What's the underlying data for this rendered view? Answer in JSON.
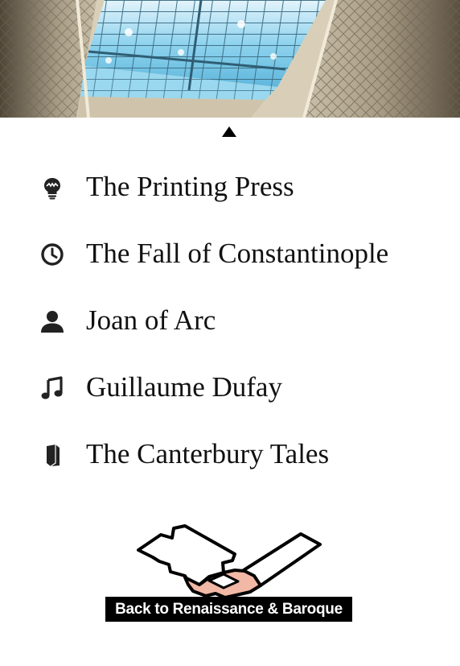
{
  "hero": {
    "image": "ornate-glass-ceiling-skylight"
  },
  "toggle": {
    "icon": "triangle-up-icon"
  },
  "topics": [
    {
      "label": "The Printing Press",
      "icon": "lightbulb-icon"
    },
    {
      "label": "The Fall of Constantinople",
      "icon": "clock-icon"
    },
    {
      "label": "Joan of Arc",
      "icon": "person-icon"
    },
    {
      "label": "Guillaume Dufay",
      "icon": "music-note-icon"
    },
    {
      "label": "The Canterbury Tales",
      "icon": "book-icon"
    }
  ],
  "back_link": {
    "label": "Back to Renaissance & Baroque",
    "map_highlight_color": "#f2b8a6"
  },
  "colors": {
    "text": "#111111",
    "button_background": "#000000",
    "button_text": "#ffffff"
  }
}
